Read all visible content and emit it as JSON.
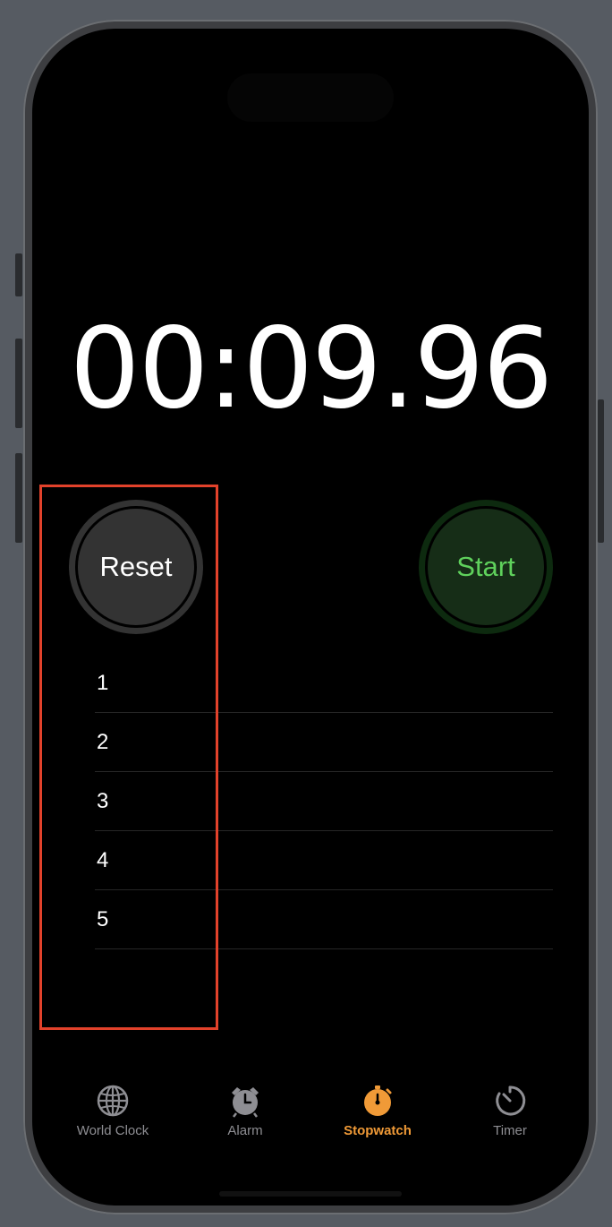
{
  "stopwatch": {
    "minutes": "00",
    "sep1": ":",
    "seconds": "09",
    "sep2": ".",
    "hundredths": "96"
  },
  "buttons": {
    "reset": "Reset",
    "start": "Start"
  },
  "laps": [
    "1",
    "2",
    "3",
    "4",
    "5"
  ],
  "tabs": [
    {
      "label": "World Clock",
      "icon": "globe-icon"
    },
    {
      "label": "Alarm",
      "icon": "alarm-icon"
    },
    {
      "label": "Stopwatch",
      "icon": "stopwatch-icon",
      "active": true
    },
    {
      "label": "Timer",
      "icon": "timer-icon"
    }
  ],
  "colors": {
    "accent": "#f09a37",
    "start_green": "#5fd15c",
    "highlight": "#e2422b"
  }
}
